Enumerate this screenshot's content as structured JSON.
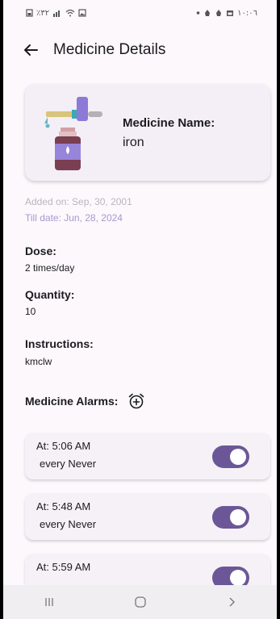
{
  "status_bar": {
    "left_text": "٪٣٢",
    "time": "١٠:٠٦"
  },
  "header": {
    "title": "Medicine Details",
    "back_icon": "arrow-left-icon"
  },
  "medicine": {
    "name_label": "Medicine Name:",
    "name_value": "iron",
    "image_icon": "medicine-bottle-dropper-icon"
  },
  "dates": {
    "added_on": "Added on: Sep, 30, 2001",
    "till_date": "Till date: Jun, 28, 2024"
  },
  "details": {
    "dose_label": "Dose:",
    "dose_value": "2 times/day",
    "quantity_label": "Quantity:",
    "quantity_value": "10",
    "instructions_label": "Instructions:",
    "instructions_value": "kmclw"
  },
  "alarms": {
    "title": "Medicine Alarms:",
    "add_icon": "add-alarm-icon",
    "items": [
      {
        "time": "At: 5:06 AM",
        "repeat": "every Never",
        "enabled": true
      },
      {
        "time": "At: 5:48 AM",
        "repeat": "every Never",
        "enabled": true
      },
      {
        "time": "At: 5:59 AM",
        "repeat": "",
        "enabled": true
      }
    ]
  },
  "nav_bar": {
    "recents_icon": "recents-icon",
    "home_icon": "home-icon",
    "back_icon": "back-chevron-icon"
  },
  "colors": {
    "accent": "#6b5797",
    "till_date": "#a59ad0",
    "background": "#fcf8fc"
  }
}
